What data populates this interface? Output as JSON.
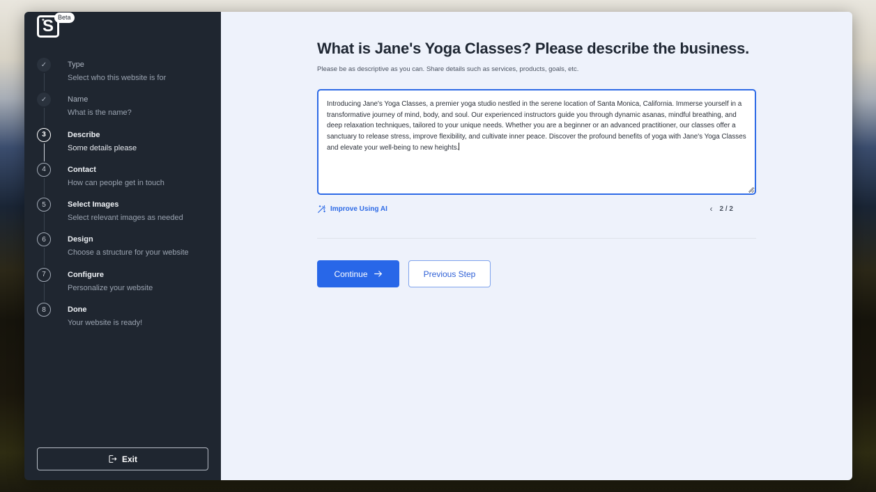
{
  "app": {
    "logo_letter": "S",
    "badge": "Beta"
  },
  "sidebar": {
    "steps": [
      {
        "marker": "✓",
        "title": "Type",
        "desc": "Select who this website is for",
        "state": "done"
      },
      {
        "marker": "✓",
        "title": "Name",
        "desc": "What is the name?",
        "state": "done"
      },
      {
        "marker": "3",
        "title": "Describe",
        "desc": "Some details please",
        "state": "current"
      },
      {
        "marker": "4",
        "title": "Contact",
        "desc": "How can people get in touch",
        "state": "todo"
      },
      {
        "marker": "5",
        "title": "Select Images",
        "desc": "Select relevant images as needed",
        "state": "todo"
      },
      {
        "marker": "6",
        "title": "Design",
        "desc": "Choose a structure for your website",
        "state": "todo"
      },
      {
        "marker": "7",
        "title": "Configure",
        "desc": "Personalize your website",
        "state": "todo"
      },
      {
        "marker": "8",
        "title": "Done",
        "desc": "Your website is ready!",
        "state": "todo"
      }
    ],
    "exit_label": "Exit"
  },
  "main": {
    "title": "What is Jane's Yoga Classes? Please describe the business.",
    "subtitle": "Please be as descriptive as you can. Share details such as services, products, goals, etc.",
    "description_value": "Introducing Jane's Yoga Classes, a premier yoga studio nestled in the serene location of Santa Monica, California. Immerse yourself in a transformative journey of mind, body, and soul. Our experienced instructors guide you through dynamic asanas, mindful breathing, and deep relaxation techniques, tailored to your unique needs. Whether you are a beginner or an advanced practitioner, our classes offer a sanctuary to release stress, improve flexibility, and cultivate inner peace. Discover the profound benefits of yoga with Jane's Yoga Classes and elevate your well-being to new heights.",
    "improve_label": "Improve Using AI",
    "pager": {
      "prev_icon": "‹",
      "current": 2,
      "total": 2,
      "text": "2 / 2"
    },
    "continue_label": "Continue",
    "previous_label": "Previous Step"
  },
  "colors": {
    "accent": "#2867e8",
    "sidebar_bg": "#1f2630",
    "main_bg": "#eef2fb"
  }
}
